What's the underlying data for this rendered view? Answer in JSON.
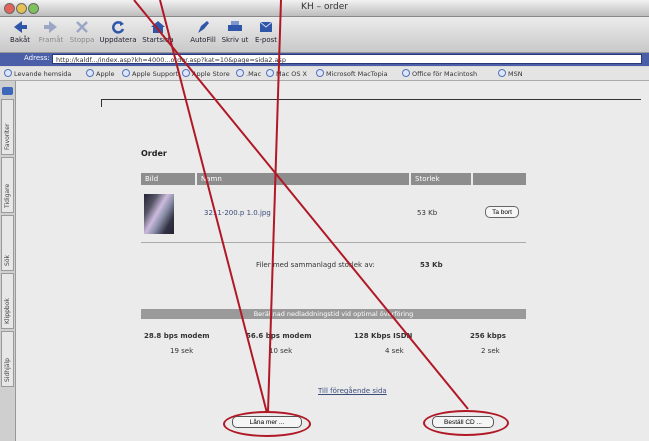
{
  "window": {
    "title": "KH – order"
  },
  "toolbar": {
    "buttons": [
      {
        "label": "Bakåt",
        "icon": "back-arrow-icon"
      },
      {
        "label": "Framåt",
        "icon": "forward-arrow-icon"
      },
      {
        "label": "Stoppa",
        "icon": "stop-x-icon"
      },
      {
        "label": "Uppdatera",
        "icon": "refresh-icon"
      },
      {
        "label": "Startsida",
        "icon": "home-icon"
      },
      {
        "label": "AutoFill",
        "icon": "autofill-icon"
      },
      {
        "label": "Skriv ut",
        "icon": "printer-icon"
      },
      {
        "label": "E-post",
        "icon": "mail-icon"
      }
    ]
  },
  "address": {
    "label": "Adress:",
    "url": "http://kaldf.../index.asp?kh=4000...order.asp?kat=10&page=sida2.asp"
  },
  "favorites": [
    "Levande hemsida",
    "Apple",
    "Apple Support",
    "Apple Store",
    ".Mac",
    "Mac OS X",
    "Microsoft MacTopia",
    "Office för Macintosh",
    "MSN"
  ],
  "side_tabs": [
    "Favoriter",
    "Tidigare",
    "Sök",
    "Klippbok",
    "Sidhjälp"
  ],
  "order": {
    "title": "Order",
    "columns": [
      "Bild",
      "Namn",
      "Storlek",
      ""
    ],
    "item": {
      "name": "3211-200.p 1.0.jpg",
      "size": "53 Kb",
      "remove_label": "Ta bort"
    },
    "total_label": "Filer med sammanlagd storlek av:",
    "total_value": "53 Kb"
  },
  "download": {
    "header": "Beräknad nedladdningstid vid optimal överföring",
    "speeds": [
      "28.8 bps modem",
      "56.6 bps modem",
      "128 Kbps ISDN",
      "256 kbps"
    ],
    "times": [
      "19 sek",
      "10 sek",
      "4 sek",
      "2 sek"
    ]
  },
  "back_link": "Till föregående sida",
  "buttons": {
    "borrow": "Låna mer ...",
    "order_cd": "Beställ CD ..."
  },
  "annotation_color": "#b01825"
}
